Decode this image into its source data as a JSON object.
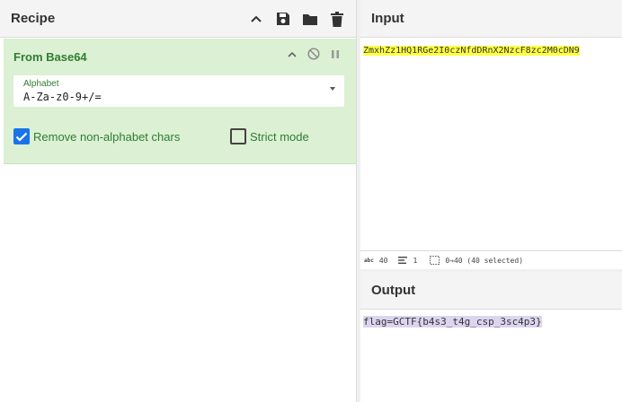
{
  "recipe": {
    "title": "Recipe",
    "header_icons": [
      "chevron-up-icon",
      "save-icon",
      "folder-icon",
      "trash-icon"
    ],
    "operation": {
      "name": "From Base64",
      "icons": [
        "chevron-up-icon",
        "disable-icon",
        "pause-icon"
      ],
      "alphabet": {
        "label": "Alphabet",
        "value": "A-Za-z0-9+/="
      },
      "options": [
        {
          "label": "Remove non-alphabet chars",
          "checked": true
        },
        {
          "label": "Strict mode",
          "checked": false
        }
      ]
    }
  },
  "input": {
    "title": "Input",
    "text": "ZmxhZz1HQ1RGe2I0czNfdDRnX2NzcF8zc2M0cDN9",
    "status": {
      "chars_icon": "abc",
      "chars": "40",
      "lines": "1",
      "selection": "0→40 (40 selected)"
    }
  },
  "output": {
    "title": "Output",
    "text": "flag=GCTF{b4s3_t4g_csp_3sc4p3}"
  },
  "colors": {
    "operation_bg": "#dcf0d4",
    "operation_text": "#2e7d32",
    "checkbox_on": "#1a73e8",
    "input_highlight": "#ffff44",
    "output_highlight": "#dcd5f0"
  }
}
